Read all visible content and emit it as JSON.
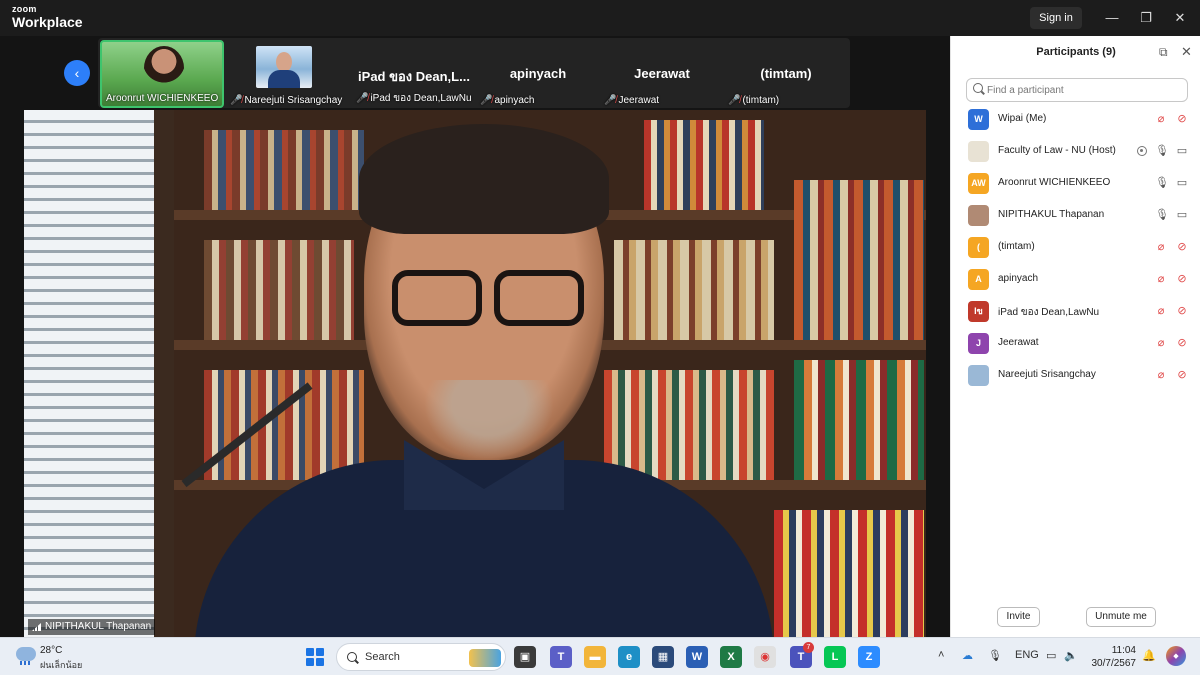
{
  "window": {
    "logo_small": "zoom",
    "logo_big": "Workplace",
    "signin_label": "Sign in",
    "minimize_glyph": "—",
    "maximize_glyph": "❐",
    "close_glyph": "✕"
  },
  "strip": {
    "tiles": [
      {
        "label": "Aroonrut WICHIENKEEO",
        "big_name": "",
        "muted": false,
        "active": true
      },
      {
        "label": "Nareejuti Srisangchay",
        "big_name": "",
        "muted": true,
        "active": false
      },
      {
        "label": "iPad ของ Dean,LawNu",
        "big_name": "iPad ของ Dean,L...",
        "muted": true,
        "active": false
      },
      {
        "label": "apinyach",
        "big_name": "apinyach",
        "muted": true,
        "active": false
      },
      {
        "label": "Jeerawat",
        "big_name": "Jeerawat",
        "muted": true,
        "active": false
      },
      {
        "label": "(timtam)",
        "big_name": "(timtam)",
        "muted": true,
        "active": false
      }
    ]
  },
  "main_video": {
    "speaker_label": "NIPITHAKUL Thapanan"
  },
  "panel": {
    "title": "Participants (9)",
    "search_placeholder": "Find a participant",
    "participants": [
      {
        "name": "Wipai (Me)",
        "avatar_text": "W",
        "avatar_color": "#2e6fd8",
        "mic_off": true,
        "cam_off": true,
        "sharing": false
      },
      {
        "name": "Faculty of Law - NU (Host)",
        "avatar_text": "",
        "avatar_color": "#e8e2d4",
        "mic_off": false,
        "cam_off": false,
        "sharing": true
      },
      {
        "name": "Aroonrut WICHIENKEEO",
        "avatar_text": "AW",
        "avatar_color": "#f5a623",
        "mic_off": false,
        "cam_off": false,
        "sharing": false
      },
      {
        "name": "NIPITHAKUL Thapanan",
        "avatar_text": "",
        "avatar_color": "#b08a74",
        "mic_off": false,
        "cam_off": false,
        "sharing": false
      },
      {
        "name": "(timtam)",
        "avatar_text": "(",
        "avatar_color": "#f5a623",
        "mic_off": true,
        "cam_off": true,
        "sharing": false
      },
      {
        "name": "apinyach",
        "avatar_text": "A",
        "avatar_color": "#f5a623",
        "mic_off": true,
        "cam_off": true,
        "sharing": false
      },
      {
        "name": "iPad ของ Dean,LawNu",
        "avatar_text": "Iข",
        "avatar_color": "#c0392b",
        "mic_off": true,
        "cam_off": true,
        "sharing": false
      },
      {
        "name": "Jeerawat",
        "avatar_text": "J",
        "avatar_color": "#8e44ad",
        "mic_off": true,
        "cam_off": true,
        "sharing": false
      },
      {
        "name": "Nareejuti Srisangchay",
        "avatar_text": "",
        "avatar_color": "#9ab8d6",
        "mic_off": true,
        "cam_off": true,
        "sharing": false
      }
    ],
    "invite_label": "Invite",
    "unmute_label": "Unmute me"
  },
  "taskbar": {
    "weather_temp": "28°C",
    "weather_desc": "ฝนเล็กน้อย",
    "search_label": "Search",
    "language": "ENG",
    "time": "11:04",
    "date": "30/7/2567",
    "teams_badge": "7"
  }
}
